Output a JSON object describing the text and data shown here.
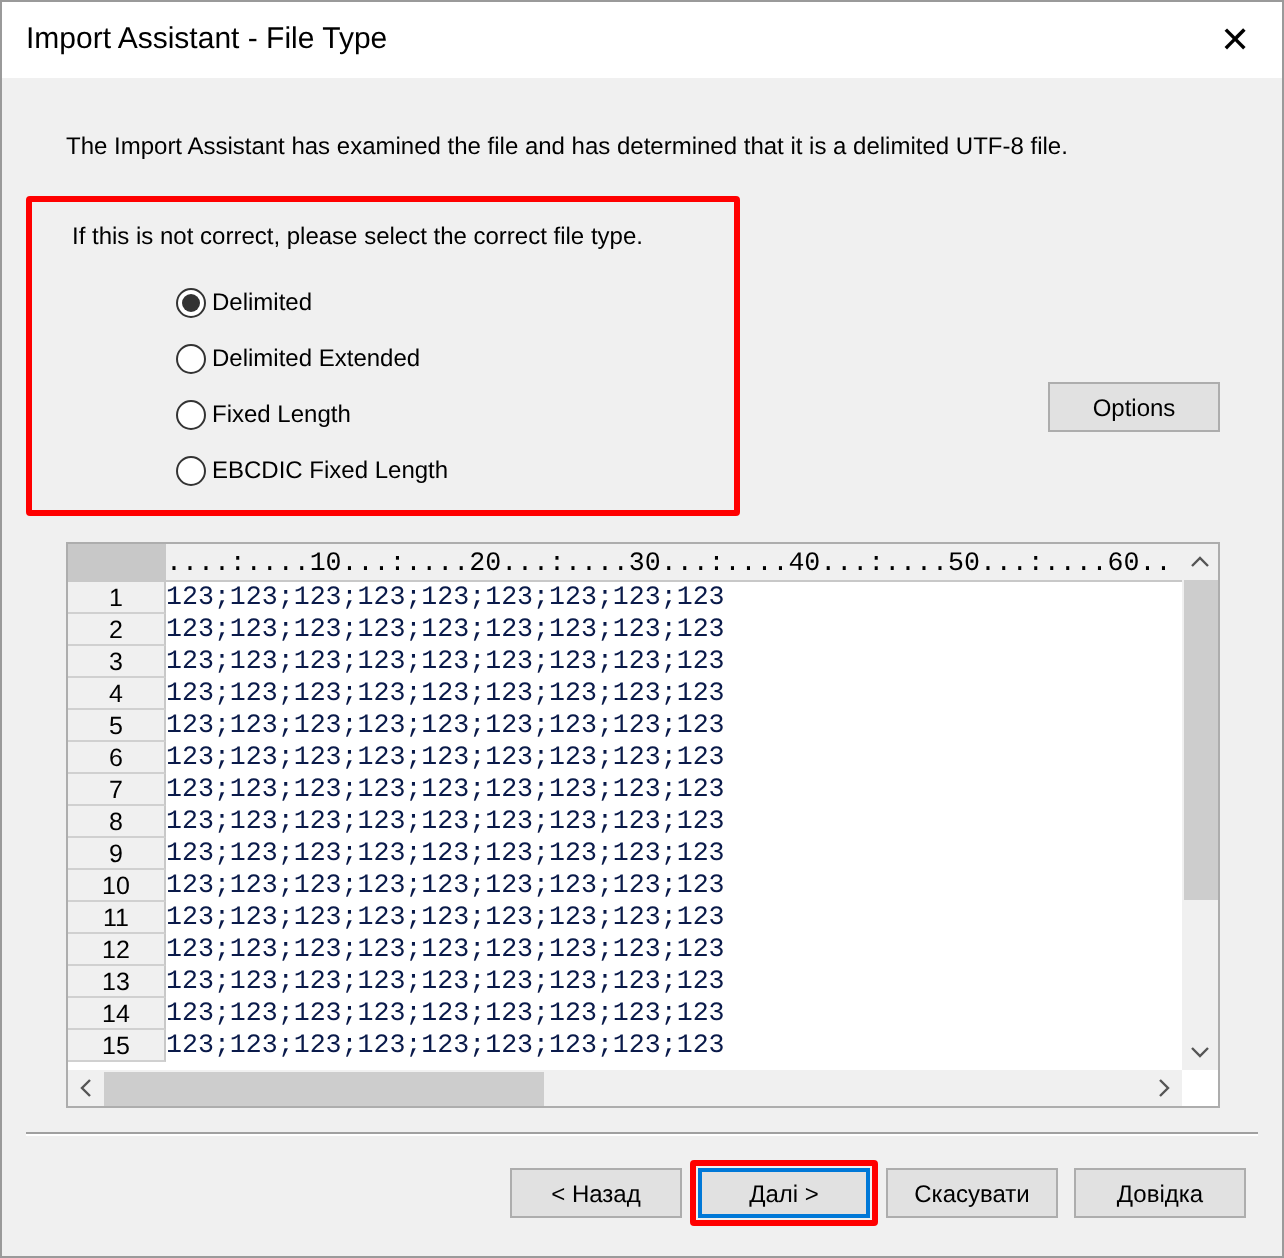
{
  "window": {
    "title": "Import Assistant - File Type",
    "close_glyph": "✕"
  },
  "intro": "The Import Assistant has examined the file and has determined that it is a delimited UTF-8 file.",
  "file_type_group": {
    "highlighted": true,
    "prompt": "If this is not correct, please select the correct file type.",
    "options": [
      {
        "label": "Delimited",
        "selected": true
      },
      {
        "label": "Delimited Extended",
        "selected": false
      },
      {
        "label": "Fixed Length",
        "selected": false
      },
      {
        "label": "EBCDIC Fixed Length",
        "selected": false
      }
    ]
  },
  "options_button": "Options",
  "preview": {
    "ruler": "....:....10...:....20...:....30...:....40...:....50...:....60..",
    "rows": [
      {
        "number": "1",
        "text": "123;123;123;123;123;123;123;123;123"
      },
      {
        "number": "2",
        "text": "123;123;123;123;123;123;123;123;123"
      },
      {
        "number": "3",
        "text": "123;123;123;123;123;123;123;123;123"
      },
      {
        "number": "4",
        "text": "123;123;123;123;123;123;123;123;123"
      },
      {
        "number": "5",
        "text": "123;123;123;123;123;123;123;123;123"
      },
      {
        "number": "6",
        "text": "123;123;123;123;123;123;123;123;123"
      },
      {
        "number": "7",
        "text": "123;123;123;123;123;123;123;123;123"
      },
      {
        "number": "8",
        "text": "123;123;123;123;123;123;123;123;123"
      },
      {
        "number": "9",
        "text": "123;123;123;123;123;123;123;123;123"
      },
      {
        "number": "10",
        "text": "123;123;123;123;123;123;123;123;123"
      },
      {
        "number": "11",
        "text": "123;123;123;123;123;123;123;123;123"
      },
      {
        "number": "12",
        "text": "123;123;123;123;123;123;123;123;123"
      },
      {
        "number": "13",
        "text": "123;123;123;123;123;123;123;123;123"
      },
      {
        "number": "14",
        "text": "123;123;123;123;123;123;123;123;123"
      },
      {
        "number": "15",
        "text": "123;123;123;123;123;123;123;123;123"
      }
    ]
  },
  "buttons": [
    {
      "label": "< Назад",
      "default": false,
      "highlighted": false
    },
    {
      "label": "Далі >",
      "default": true,
      "highlighted": true
    },
    {
      "label": "Скасувати",
      "default": false,
      "highlighted": false
    },
    {
      "label": "Довідка",
      "default": false,
      "highlighted": false
    }
  ]
}
